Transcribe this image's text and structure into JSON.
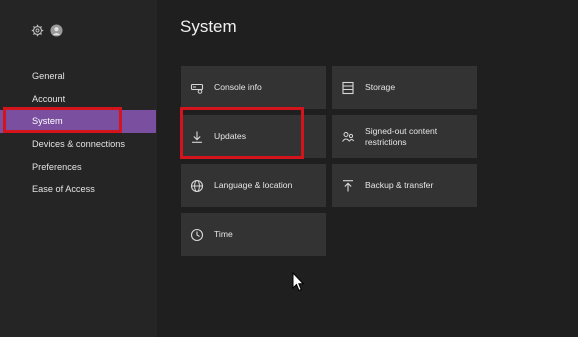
{
  "sidebar": {
    "items": [
      {
        "label": "General"
      },
      {
        "label": "Account"
      },
      {
        "label": "System"
      },
      {
        "label": "Devices & connections"
      },
      {
        "label": "Preferences"
      },
      {
        "label": "Ease of Access"
      }
    ],
    "active": "System"
  },
  "page": {
    "title": "System"
  },
  "tiles": [
    {
      "label": "Console info",
      "icon": "console-info-icon"
    },
    {
      "label": "Storage",
      "icon": "storage-icon"
    },
    {
      "label": "Updates",
      "icon": "download-icon"
    },
    {
      "label": "Signed-out content restrictions",
      "icon": "people-icon"
    },
    {
      "label": "Language & location",
      "icon": "globe-icon"
    },
    {
      "label": "Backup & transfer",
      "icon": "upload-icon"
    },
    {
      "label": "Time",
      "icon": "clock-icon"
    }
  ],
  "colors": {
    "accent": "#7a4fa0",
    "highlight": "#d4141c",
    "tile": "#333333",
    "background": "#1f1f1f"
  }
}
